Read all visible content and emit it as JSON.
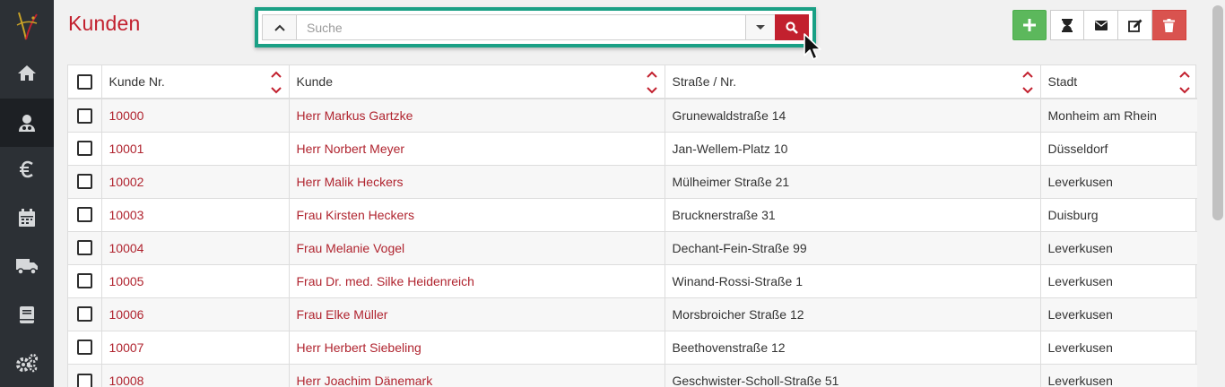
{
  "page": {
    "title": "Kunden"
  },
  "search": {
    "placeholder": "Suche",
    "value": ""
  },
  "colors": {
    "accent": "#c2202e",
    "highlight": "#1aa085",
    "sidebar": "#2c3035",
    "add": "#5cb85c",
    "delete": "#d9534f"
  },
  "sidebar": {
    "items": [
      {
        "icon": "home-icon",
        "active": false
      },
      {
        "icon": "customers-icon",
        "active": true
      },
      {
        "icon": "euro-icon",
        "active": false
      },
      {
        "icon": "calendar-icon",
        "active": false
      },
      {
        "icon": "truck-icon",
        "active": false
      },
      {
        "icon": "book-icon",
        "active": false
      },
      {
        "icon": "settings-icon",
        "active": false
      }
    ]
  },
  "toolbar": [
    "add-icon",
    "hourglass-icon",
    "envelope-icon",
    "edit-icon",
    "trash-icon"
  ],
  "table": {
    "columns": [
      "Kunde Nr.",
      "Kunde",
      "Straße / Nr.",
      "Stadt"
    ],
    "rows": [
      [
        "10000",
        "Herr Markus Gartzke",
        "Grunewaldstraße 14",
        "Monheim am Rhein"
      ],
      [
        "10001",
        "Herr Norbert Meyer",
        "Jan-Wellem-Platz 10",
        "Düsseldorf"
      ],
      [
        "10002",
        "Herr Malik Heckers",
        "Mülheimer Straße 21",
        "Leverkusen"
      ],
      [
        "10003",
        "Frau Kirsten Heckers",
        "Brucknerstraße 31",
        "Duisburg"
      ],
      [
        "10004",
        "Frau Melanie Vogel",
        "Dechant-Fein-Straße 99",
        "Leverkusen"
      ],
      [
        "10005",
        "Frau Dr. med. Silke Heidenreich",
        "Winand-Rossi-Straße 1",
        "Leverkusen"
      ],
      [
        "10006",
        "Frau Elke Müller",
        "Morsbroicher Straße 12",
        "Leverkusen"
      ],
      [
        "10007",
        "Herr Herbert Siebeling",
        "Beethovenstraße 12",
        "Leverkusen"
      ],
      [
        "10008",
        "Herr Joachim Dänemark",
        "Geschwister-Scholl-Straße 51",
        "Leverkusen"
      ]
    ]
  }
}
